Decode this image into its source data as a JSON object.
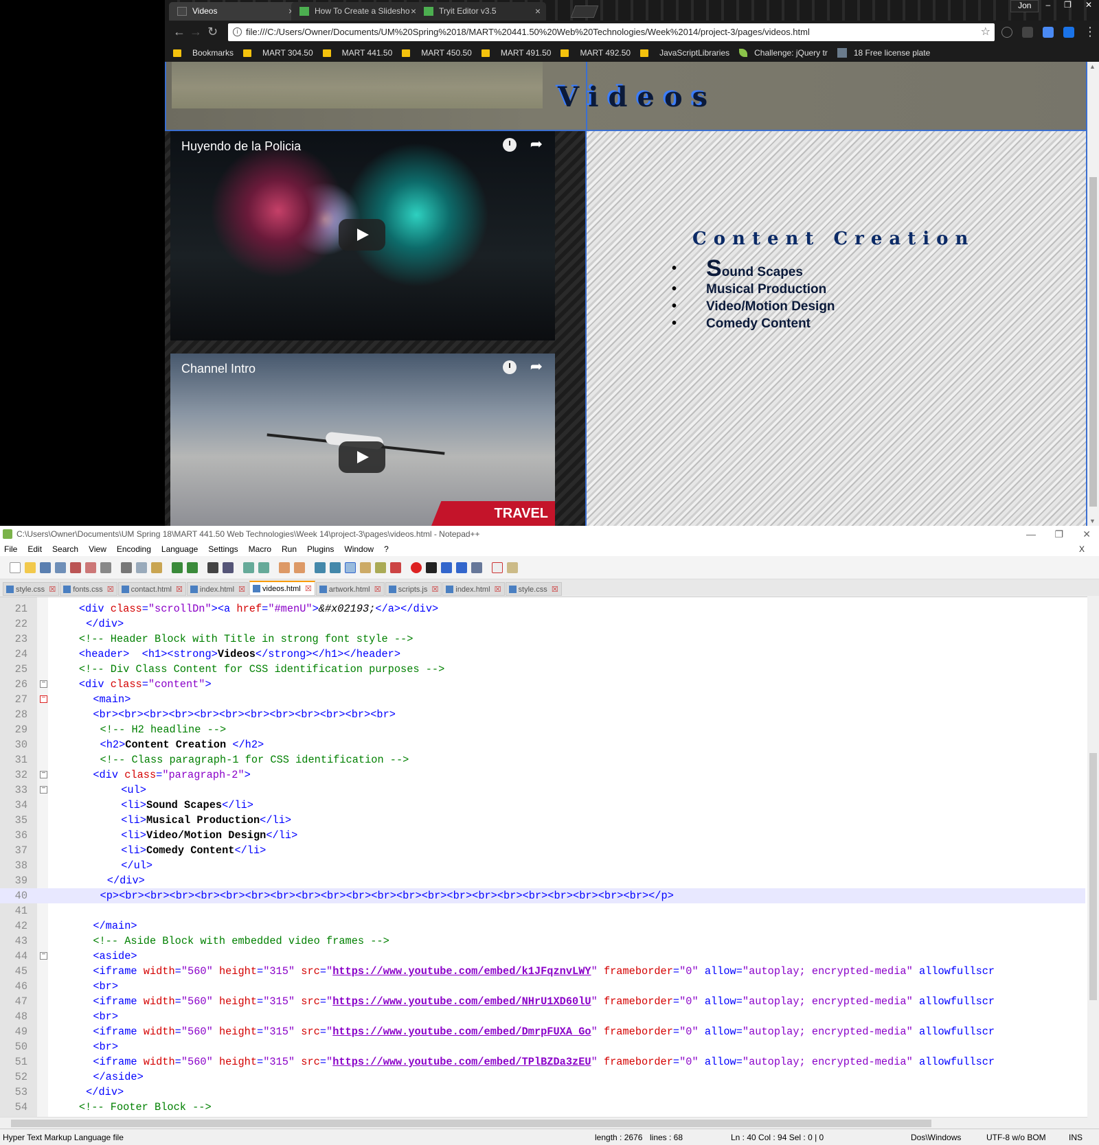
{
  "browser": {
    "tabs": [
      {
        "title": "Videos",
        "active": true
      },
      {
        "title": "How To Create a Slidesho",
        "active": false
      },
      {
        "title": "Tryit Editor v3.5",
        "active": false
      }
    ],
    "profile_name": "Jon",
    "address": "file:///C:/Users/Owner/Documents/UM%20Spring%2018/MART%20441.50%20Web%20Technologies/Week%2014/project-3/pages/videos.html",
    "bookmarks": [
      {
        "label": "Bookmarks",
        "icon": "folder-icon"
      },
      {
        "label": "MART 304.50",
        "icon": "folder-icon"
      },
      {
        "label": "MART 441.50",
        "icon": "folder-icon"
      },
      {
        "label": "MART 450.50",
        "icon": "folder-icon"
      },
      {
        "label": "MART 491.50",
        "icon": "folder-icon"
      },
      {
        "label": "MART 492.50",
        "icon": "folder-icon"
      },
      {
        "label": "JavaScriptLibraries",
        "icon": "folder-icon"
      },
      {
        "label": "Challenge: jQuery tr",
        "icon": "leaf-icon"
      },
      {
        "label": "18 Free license plate",
        "icon": "site-icon"
      }
    ]
  },
  "page": {
    "title": "Videos",
    "videos": [
      {
        "title": "Huyendo de la Policia"
      },
      {
        "title": "Channel Intro",
        "badge": "TRAVEL"
      }
    ],
    "content_heading": "Content Creation",
    "list_items": [
      {
        "first": "S",
        "rest": "ound Scapes"
      },
      {
        "first": "",
        "rest": "Musical Production"
      },
      {
        "first": "",
        "rest": "Video/Motion Design"
      },
      {
        "first": "",
        "rest": "Comedy Content"
      }
    ]
  },
  "editor": {
    "window_title": "C:\\Users\\Owner\\Documents\\UM Spring 18\\MART 441.50 Web Technologies\\Week 14\\project-3\\pages\\videos.html - Notepad++",
    "menu": [
      "File",
      "Edit",
      "Search",
      "View",
      "Encoding",
      "Language",
      "Settings",
      "Macro",
      "Run",
      "Plugins",
      "Window",
      "?"
    ],
    "menu_close": "X",
    "file_tabs": [
      {
        "name": "style.css",
        "active": false
      },
      {
        "name": "fonts.css",
        "active": false
      },
      {
        "name": "contact.html",
        "active": false
      },
      {
        "name": "index.html",
        "active": false
      },
      {
        "name": "videos.html",
        "active": true
      },
      {
        "name": "artwork.html",
        "active": false
      },
      {
        "name": "scripts.js",
        "active": false
      },
      {
        "name": "index.html",
        "active": false
      },
      {
        "name": "style.css",
        "active": false
      }
    ],
    "code_lines": [
      {
        "n": "21",
        "fold": "",
        "current": false,
        "indent": 8,
        "segs": [
          [
            "t",
            "<div "
          ],
          [
            "a",
            "class"
          ],
          [
            "t",
            "="
          ],
          [
            "v",
            "\"scrollDn\""
          ],
          [
            "t",
            ">"
          ],
          [
            "t",
            "<a "
          ],
          [
            "a",
            "href"
          ],
          [
            "t",
            "="
          ],
          [
            "v",
            "\"#menU\""
          ],
          [
            "t",
            ">"
          ],
          [
            "e",
            "&#x02193;"
          ],
          [
            "t",
            "</a></div>"
          ]
        ]
      },
      {
        "n": "22",
        "fold": "",
        "current": false,
        "indent": 10,
        "segs": [
          [
            "t",
            "</div>"
          ]
        ]
      },
      {
        "n": "23",
        "fold": "",
        "current": false,
        "indent": 8,
        "segs": [
          [
            "c",
            "<!-- Header Block with Title in strong font style -->"
          ]
        ]
      },
      {
        "n": "24",
        "fold": "",
        "current": false,
        "indent": 8,
        "segs": [
          [
            "t",
            "<header>  <h1><strong>"
          ],
          [
            "x",
            "Videos"
          ],
          [
            "t",
            "</strong></h1></header>"
          ]
        ]
      },
      {
        "n": "25",
        "fold": "",
        "current": false,
        "indent": 8,
        "segs": [
          [
            "c",
            "<!-- Div Class Content for CSS identification purposes -->"
          ]
        ]
      },
      {
        "n": "26",
        "fold": "minus",
        "current": false,
        "indent": 8,
        "segs": [
          [
            "t",
            "<div "
          ],
          [
            "a",
            "class"
          ],
          [
            "t",
            "="
          ],
          [
            "v",
            "\"content\""
          ],
          [
            "t",
            ">"
          ]
        ]
      },
      {
        "n": "27",
        "fold": "minus-red",
        "current": false,
        "indent": 12,
        "segs": [
          [
            "t",
            "<main>"
          ]
        ]
      },
      {
        "n": "28",
        "fold": "",
        "current": false,
        "indent": 12,
        "segs": [
          [
            "t",
            "<br><br><br><br><br><br><br><br><br><br><br><br>"
          ]
        ]
      },
      {
        "n": "29",
        "fold": "",
        "current": false,
        "indent": 14,
        "segs": [
          [
            "c",
            "<!-- H2 headline -->"
          ]
        ]
      },
      {
        "n": "30",
        "fold": "",
        "current": false,
        "indent": 14,
        "segs": [
          [
            "t",
            "<h2>"
          ],
          [
            "x",
            "Content Creation "
          ],
          [
            "t",
            "</h2>"
          ]
        ]
      },
      {
        "n": "31",
        "fold": "",
        "current": false,
        "indent": 14,
        "segs": [
          [
            "c",
            "<!-- Class paragraph-1 for CSS identification -->"
          ]
        ]
      },
      {
        "n": "32",
        "fold": "minus",
        "current": false,
        "indent": 12,
        "segs": [
          [
            "t",
            "<div "
          ],
          [
            "a",
            "class"
          ],
          [
            "t",
            "="
          ],
          [
            "v",
            "\"paragraph-2\""
          ],
          [
            "t",
            ">"
          ]
        ]
      },
      {
        "n": "33",
        "fold": "minus",
        "current": false,
        "indent": 20,
        "segs": [
          [
            "t",
            "<ul>"
          ]
        ]
      },
      {
        "n": "34",
        "fold": "",
        "current": false,
        "indent": 20,
        "segs": [
          [
            "t",
            "<li>"
          ],
          [
            "x",
            "Sound Scapes"
          ],
          [
            "t",
            "</li>"
          ]
        ]
      },
      {
        "n": "35",
        "fold": "",
        "current": false,
        "indent": 20,
        "segs": [
          [
            "t",
            "<li>"
          ],
          [
            "x",
            "Musical Production"
          ],
          [
            "t",
            "</li>"
          ]
        ]
      },
      {
        "n": "36",
        "fold": "",
        "current": false,
        "indent": 20,
        "segs": [
          [
            "t",
            "<li>"
          ],
          [
            "x",
            "Video/Motion Design"
          ],
          [
            "t",
            "</li>"
          ]
        ]
      },
      {
        "n": "37",
        "fold": "",
        "current": false,
        "indent": 20,
        "segs": [
          [
            "t",
            "<li>"
          ],
          [
            "x",
            "Comedy Content"
          ],
          [
            "t",
            "</li>"
          ]
        ]
      },
      {
        "n": "38",
        "fold": "",
        "current": false,
        "indent": 20,
        "segs": [
          [
            "t",
            "</ul>"
          ]
        ]
      },
      {
        "n": "39",
        "fold": "",
        "current": false,
        "indent": 16,
        "segs": [
          [
            "t",
            "</div>"
          ]
        ]
      },
      {
        "n": "40",
        "fold": "",
        "current": true,
        "indent": 14,
        "segs": [
          [
            "t",
            "<p><br><br><br><br><br><br><br><br><br><br><br><br><br><br><br><br><br><br><br><br><br></p>"
          ]
        ]
      },
      {
        "n": "41",
        "fold": "",
        "current": false,
        "indent": 0,
        "segs": []
      },
      {
        "n": "42",
        "fold": "",
        "current": false,
        "indent": 12,
        "segs": [
          [
            "t",
            "</main>"
          ]
        ]
      },
      {
        "n": "43",
        "fold": "",
        "current": false,
        "indent": 12,
        "segs": [
          [
            "c",
            "<!-- Aside Block with embedded video frames -->"
          ]
        ]
      },
      {
        "n": "44",
        "fold": "minus",
        "current": false,
        "indent": 12,
        "segs": [
          [
            "t",
            "<aside>"
          ]
        ]
      },
      {
        "n": "45",
        "fold": "",
        "current": false,
        "indent": 12,
        "segs": [
          [
            "t",
            "<iframe "
          ],
          [
            "a",
            "width"
          ],
          [
            "t",
            "="
          ],
          [
            "v",
            "\"560\" "
          ],
          [
            "a",
            "height"
          ],
          [
            "t",
            "="
          ],
          [
            "v",
            "\"315\" "
          ],
          [
            "a",
            "src"
          ],
          [
            "t",
            "="
          ],
          [
            "v",
            "\""
          ],
          [
            "u",
            "https://www.youtube.com/embed/k1JFqznvLWY"
          ],
          [
            "v",
            "\" "
          ],
          [
            "a",
            "frameborder"
          ],
          [
            "t",
            "="
          ],
          [
            "v",
            "\"0\" "
          ],
          [
            "t",
            "allow"
          ],
          [
            "t",
            "="
          ],
          [
            "v",
            "\"autoplay; encrypted-media\" "
          ],
          [
            "t",
            "allowfullscr"
          ]
        ]
      },
      {
        "n": "46",
        "fold": "",
        "current": false,
        "indent": 12,
        "segs": [
          [
            "t",
            "<br>"
          ]
        ]
      },
      {
        "n": "47",
        "fold": "",
        "current": false,
        "indent": 12,
        "segs": [
          [
            "t",
            "<iframe "
          ],
          [
            "a",
            "width"
          ],
          [
            "t",
            "="
          ],
          [
            "v",
            "\"560\" "
          ],
          [
            "a",
            "height"
          ],
          [
            "t",
            "="
          ],
          [
            "v",
            "\"315\" "
          ],
          [
            "a",
            "src"
          ],
          [
            "t",
            "="
          ],
          [
            "v",
            "\""
          ],
          [
            "u",
            "https://www.youtube.com/embed/NHrU1XD60lU"
          ],
          [
            "v",
            "\" "
          ],
          [
            "a",
            "frameborder"
          ],
          [
            "t",
            "="
          ],
          [
            "v",
            "\"0\" "
          ],
          [
            "t",
            "allow"
          ],
          [
            "t",
            "="
          ],
          [
            "v",
            "\"autoplay; encrypted-media\" "
          ],
          [
            "t",
            "allowfullscr"
          ]
        ]
      },
      {
        "n": "48",
        "fold": "",
        "current": false,
        "indent": 12,
        "segs": [
          [
            "t",
            "<br>"
          ]
        ]
      },
      {
        "n": "49",
        "fold": "",
        "current": false,
        "indent": 12,
        "segs": [
          [
            "t",
            "<iframe "
          ],
          [
            "a",
            "width"
          ],
          [
            "t",
            "="
          ],
          [
            "v",
            "\"560\" "
          ],
          [
            "a",
            "height"
          ],
          [
            "t",
            "="
          ],
          [
            "v",
            "\"315\" "
          ],
          [
            "a",
            "src"
          ],
          [
            "t",
            "="
          ],
          [
            "v",
            "\""
          ],
          [
            "u",
            "https://www.youtube.com/embed/DmrpFUXA_Go"
          ],
          [
            "v",
            "\" "
          ],
          [
            "a",
            "frameborder"
          ],
          [
            "t",
            "="
          ],
          [
            "v",
            "\"0\" "
          ],
          [
            "t",
            "allow"
          ],
          [
            "t",
            "="
          ],
          [
            "v",
            "\"autoplay; encrypted-media\" "
          ],
          [
            "t",
            "allowfullscr"
          ]
        ]
      },
      {
        "n": "50",
        "fold": "",
        "current": false,
        "indent": 12,
        "segs": [
          [
            "t",
            "<br>"
          ]
        ]
      },
      {
        "n": "51",
        "fold": "",
        "current": false,
        "indent": 12,
        "segs": [
          [
            "t",
            "<iframe "
          ],
          [
            "a",
            "width"
          ],
          [
            "t",
            "="
          ],
          [
            "v",
            "\"560\" "
          ],
          [
            "a",
            "height"
          ],
          [
            "t",
            "="
          ],
          [
            "v",
            "\"315\" "
          ],
          [
            "a",
            "src"
          ],
          [
            "t",
            "="
          ],
          [
            "v",
            "\""
          ],
          [
            "u",
            "https://www.youtube.com/embed/TPlBZDa3zEU"
          ],
          [
            "v",
            "\" "
          ],
          [
            "a",
            "frameborder"
          ],
          [
            "t",
            "="
          ],
          [
            "v",
            "\"0\" "
          ],
          [
            "t",
            "allow"
          ],
          [
            "t",
            "="
          ],
          [
            "v",
            "\"autoplay; encrypted-media\" "
          ],
          [
            "t",
            "allowfullscr"
          ]
        ]
      },
      {
        "n": "52",
        "fold": "",
        "current": false,
        "indent": 12,
        "segs": [
          [
            "t",
            "</aside>"
          ]
        ]
      },
      {
        "n": "53",
        "fold": "",
        "current": false,
        "indent": 10,
        "segs": [
          [
            "t",
            "</div>"
          ]
        ]
      },
      {
        "n": "54",
        "fold": "",
        "current": false,
        "indent": 8,
        "segs": [
          [
            "c",
            "<!-- Footer Block -->"
          ]
        ]
      }
    ],
    "status": {
      "filetype": "Hyper Text Markup Language file",
      "length": "length : 2676",
      "lines": "lines : 68",
      "position": "Ln : 40    Col : 94    Sel : 0 | 0",
      "eol": "Dos\\Windows",
      "encoding": "UTF-8 w/o BOM",
      "mode": "INS"
    },
    "colors": {
      "tag": "#0000ff",
      "attribute": "#d40000",
      "value": "#8a00c8",
      "comment": "#008000",
      "current_line": "#e8e8ff"
    }
  }
}
